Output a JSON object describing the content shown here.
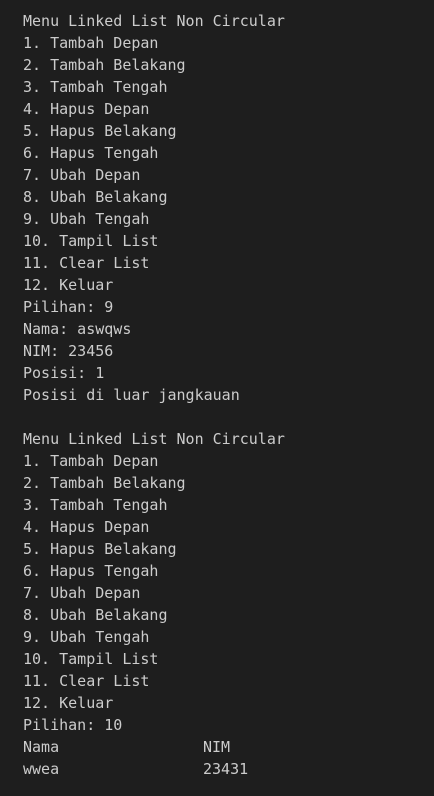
{
  "colors": {
    "background": "#1e1e1e",
    "text": "#cccccc"
  },
  "block1": {
    "menu_title": "Menu Linked List Non Circular",
    "menu_items": [
      "1. Tambah Depan",
      "2. Tambah Belakang",
      "3. Tambah Tengah",
      "4. Hapus Depan",
      "5. Hapus Belakang",
      "6. Hapus Tengah",
      "7. Ubah Depan",
      "8. Ubah Belakang",
      "9. Ubah Tengah",
      "10. Tampil List",
      "11. Clear List",
      "12. Keluar"
    ],
    "choice": "Pilihan: 9",
    "nama": "Nama: aswqws",
    "nim": "NIM: 23456",
    "posisi": "Posisi: 1",
    "message": "Posisi di luar jangkauan"
  },
  "block2": {
    "menu_title": "Menu Linked List Non Circular",
    "menu_items": [
      "1. Tambah Depan",
      "2. Tambah Belakang",
      "3. Tambah Tengah",
      "4. Hapus Depan",
      "5. Hapus Belakang",
      "6. Hapus Tengah",
      "7. Ubah Depan",
      "8. Ubah Belakang",
      "9. Ubah Tengah",
      "10. Tampil List",
      "11. Clear List",
      "12. Keluar"
    ],
    "choice": "Pilihan: 10"
  },
  "table": {
    "headers": [
      "Nama",
      "NIM"
    ],
    "rows": [
      [
        "wwea",
        "23431"
      ]
    ]
  }
}
